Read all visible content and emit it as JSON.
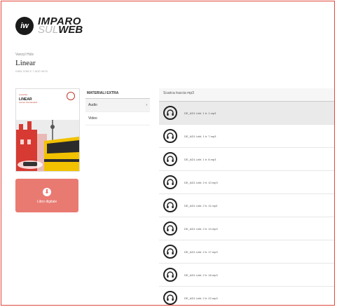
{
  "logo": {
    "badge": "iw",
    "top": "IMPARO",
    "bottom_light": "SUL",
    "bottom_bold": "WEB"
  },
  "breadcrumb": "Vanzyl Hüls",
  "book_title": "Linear",
  "book_meta": "ISBN 9788 E 7 ADD 9876",
  "cover": {
    "brand": "Loescher",
    "name": "LINEAR",
    "subtitle": "Lernen Sie Deutsch"
  },
  "digital_button": {
    "label": "Libro digitale"
  },
  "materials": {
    "title": "MATERIALI EXTRA",
    "items": [
      {
        "label": "Audio",
        "arrow": "›"
      },
      {
        "label": "Video",
        "arrow": ""
      }
    ]
  },
  "tracks": {
    "header": "Scarica traccia mp3",
    "items": [
      {
        "name": "DE_AD1 Lekt. 1 tr. 1.mp3"
      },
      {
        "name": "DE_AD1 Lekt. 1 tr. 7.mp3"
      },
      {
        "name": "DE_AD1 Lekt. 1 tr. 8.mp3"
      },
      {
        "name": "DE_AD1 Lekt. 2 tr. 10.mp3"
      },
      {
        "name": "DE_AD1 Lekt. 2 tr. 11.mp3"
      },
      {
        "name": "DE_AD1 Lekt. 2 tr. 14.mp3"
      },
      {
        "name": "DE_AD1 Lekt. 2 tr. 17.mp3"
      },
      {
        "name": "DE_AD1 Lekt. 2 tr. 18.mp3"
      },
      {
        "name": "DE_AD1 Lekt. 2 tr. 22.mp3"
      }
    ]
  },
  "colors": {
    "accent": "#e2483c",
    "button": "#e97a72",
    "dark": "#1a1a1a"
  }
}
